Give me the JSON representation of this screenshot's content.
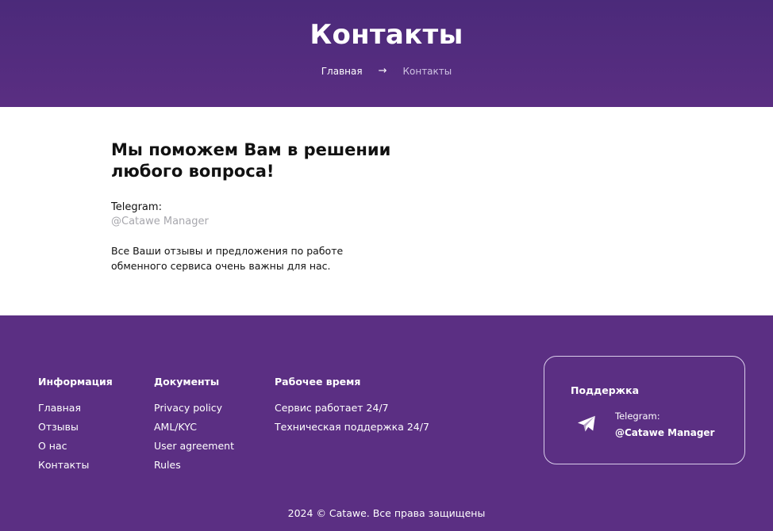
{
  "hero": {
    "title": "Контакты",
    "breadcrumb": {
      "home": "Главная",
      "arrow": "→",
      "current": "Контакты"
    }
  },
  "content": {
    "heading_line1": "Мы поможем Вам в решении",
    "heading_line2": "любого вопроса!",
    "telegram_label": "Telegram:",
    "telegram_handle": "@Catawe Manager",
    "description": "Все Ваши отзывы и предложения по работе обменного сервиса очень важны для нас."
  },
  "footer": {
    "info": {
      "title": "Информация",
      "links": [
        "Главная",
        "Отзывы",
        "О нас",
        "Контакты"
      ]
    },
    "docs": {
      "title": "Документы",
      "links": [
        "Privacy policy",
        "AML/KYC",
        "User agreement",
        "Rules"
      ]
    },
    "hours": {
      "title": "Рабочее время",
      "lines": [
        "Сервис работает 24/7",
        "Техническая поддержка 24/7"
      ]
    },
    "support": {
      "title": "Поддержка",
      "icon": "telegram-icon",
      "telegram_label": "Telegram:",
      "telegram_handle": "@Catawe Manager"
    },
    "copyright": "2024 © Catawe. Все права защищены"
  },
  "colors": {
    "primary": "#5b2f83",
    "hero_top": "#4b2a7a",
    "muted_text": "#a7a7ad"
  }
}
